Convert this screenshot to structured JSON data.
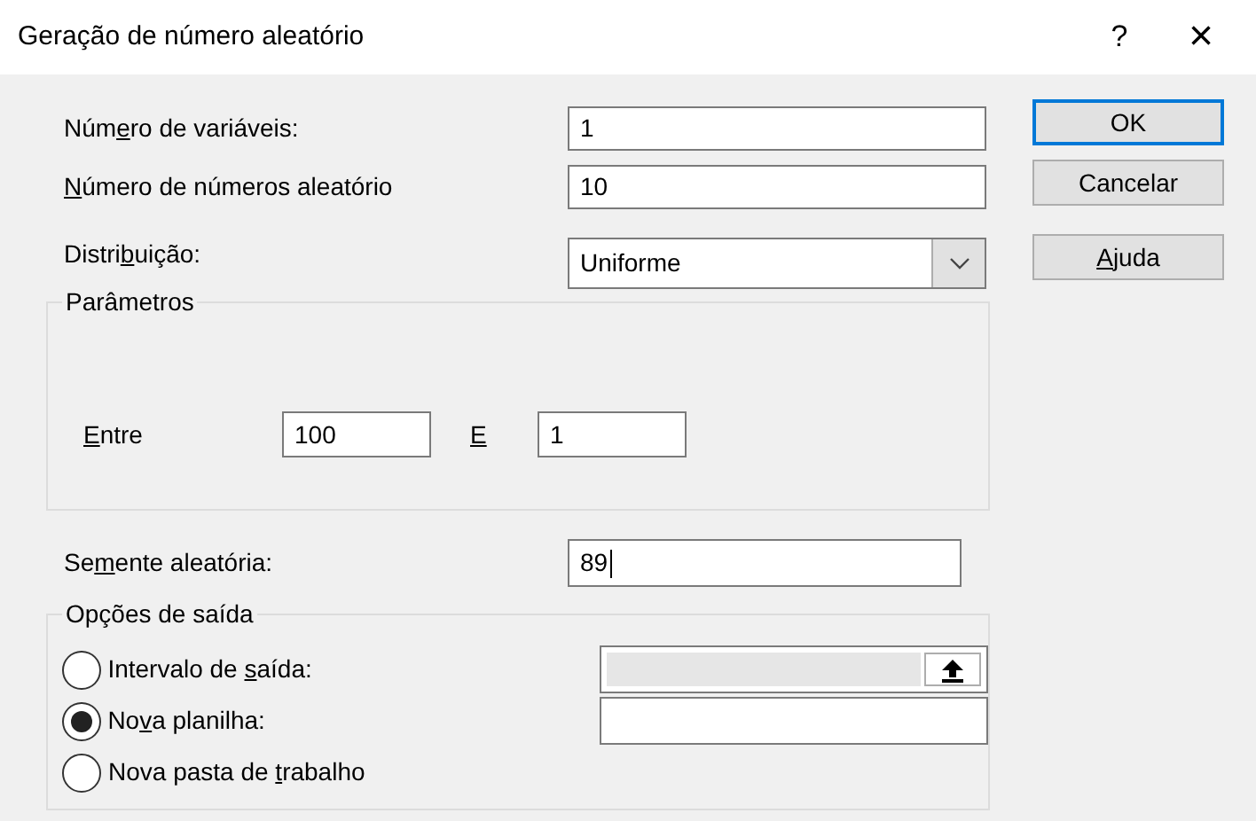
{
  "window": {
    "title": "Geração de número aleatório",
    "help": "?",
    "close": "×"
  },
  "fields": [
    {
      "label": {
        "pre": "Núm",
        "key": "e",
        "post": "ro de variáveis:"
      },
      "value": "1"
    },
    {
      "label": {
        "key": "N",
        "post": "úmero de números aleatório"
      },
      "value": "10"
    }
  ],
  "distribution": {
    "label": {
      "pre": "Distri",
      "key": "b",
      "post": "uição:"
    },
    "value": "Uniforme"
  },
  "parameters": {
    "title": "Parâmetros",
    "from": {
      "label": {
        "key": "E",
        "post": "ntre"
      },
      "value": "100"
    },
    "to": {
      "label": {
        "key": "E"
      },
      "value": "1"
    }
  },
  "seed": {
    "label": {
      "pre": "Se",
      "key": "m",
      "post": "ente aleatória:"
    },
    "value": "89",
    "focused": true
  },
  "output": {
    "title": "Opções de saída",
    "options": [
      {
        "label": {
          "pre": "Intervalo de ",
          "key": "s",
          "post": "aída:"
        },
        "selected": false,
        "kind": "range"
      },
      {
        "label": {
          "pre": "No",
          "key": "v",
          "post": "a planilha:"
        },
        "selected": true,
        "kind": "field"
      },
      {
        "label": {
          "pre": "Nova pasta de ",
          "key": "t",
          "post": "rabalho"
        },
        "selected": false,
        "kind": "none"
      }
    ]
  },
  "buttons": [
    {
      "label": {
        "post": "OK"
      },
      "default": true
    },
    {
      "label": {
        "post": "Cancelar"
      },
      "default": false
    },
    {
      "label": {
        "key": "A",
        "post": "juda"
      },
      "default": false
    }
  ]
}
